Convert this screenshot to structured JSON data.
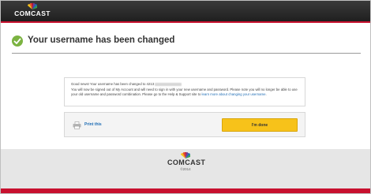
{
  "header": {
    "brand": "COMCAST"
  },
  "page": {
    "title": "Your username has been changed"
  },
  "message": {
    "line1": "Good news! Your username has been changed to 4213",
    "line2_a": "You will now be signed out of My Account and will need to sign in with your new username and password. Please note you will no longer be able to use your old username and password combination. Please go to the Help & Support site to ",
    "line2_link": "learn more about changing your username",
    "line2_b": "."
  },
  "actions": {
    "print_label": "Print this",
    "done_label": "I'm done"
  },
  "footer": {
    "brand": "COMCAST",
    "copyright": "©2014"
  },
  "colors": {
    "header_bg": "#1f1f1f",
    "accent_red": "#c8102e",
    "success_green": "#7cb342",
    "button_yellow": "#f7c21a",
    "link_blue": "#1f6db5"
  },
  "icons": [
    "nbc-peacock-logo-icon",
    "checkmark-circle-icon",
    "printer-icon"
  ]
}
